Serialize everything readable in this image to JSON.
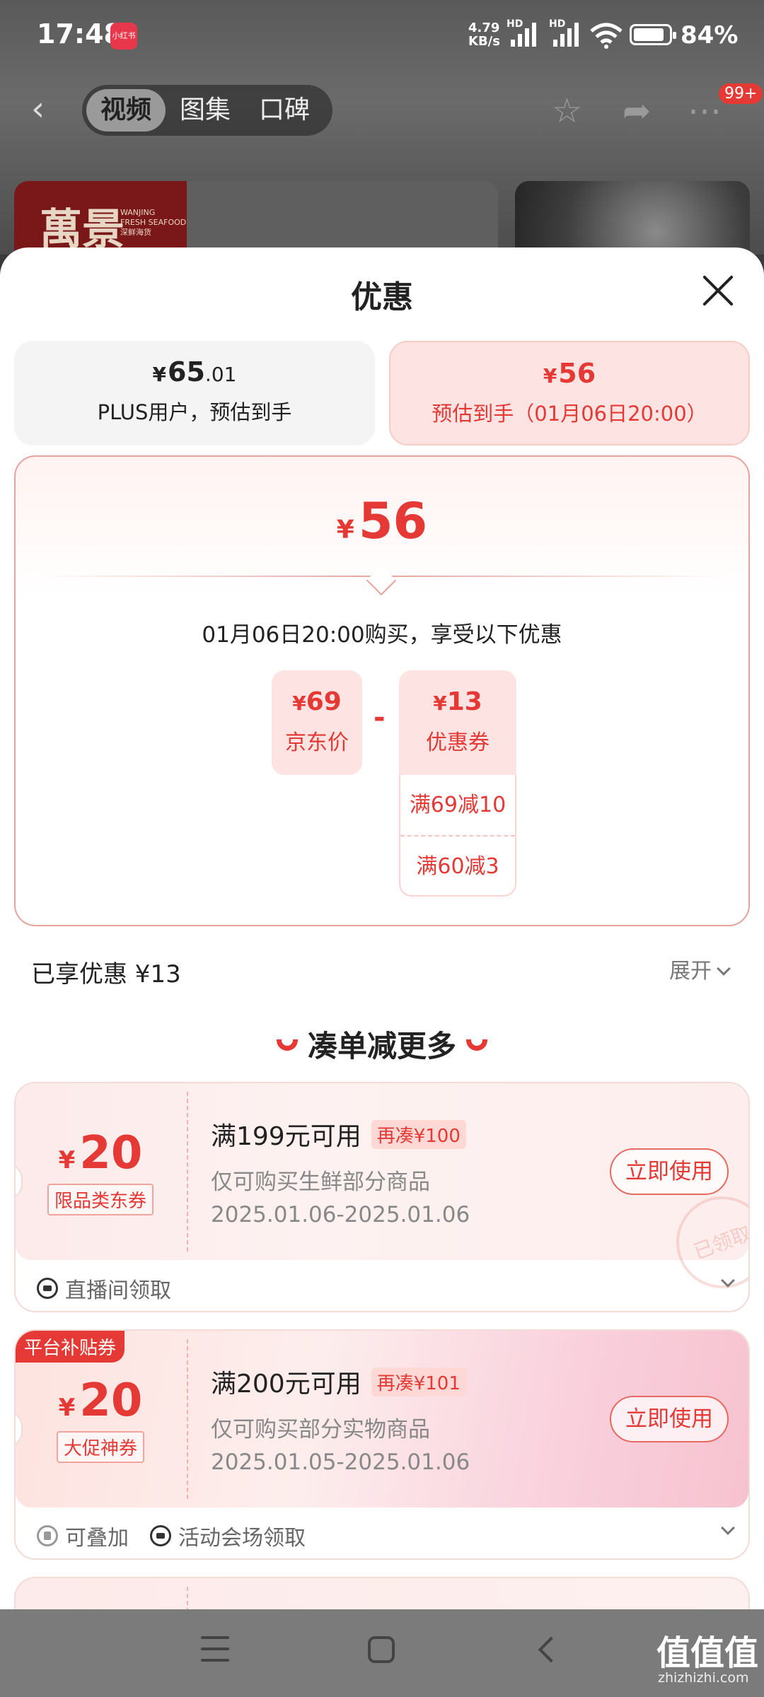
{
  "status_bar": {
    "time": "17:48",
    "app_icon_label": "小红书",
    "net_speed_value": "4.79",
    "net_speed_unit": "KB/s",
    "hd1": "HD",
    "hd2": "HD",
    "battery": "84%"
  },
  "top_nav": {
    "tabs": [
      {
        "label": "视频",
        "active": true
      },
      {
        "label": "图集",
        "active": false
      },
      {
        "label": "口碑",
        "active": false
      }
    ],
    "notification_badge": "99+"
  },
  "background_card": {
    "logo_big": "萬景",
    "logo_en1": "WANJING",
    "logo_en2": "FRESH SEAFOOD",
    "logo_cn_small": "深鲜海货"
  },
  "sheet": {
    "title": "优惠",
    "price_tabs": [
      {
        "currency": "¥",
        "price_int": "65",
        "price_dec": ".01",
        "desc": "PLUS用户，预估到手",
        "selected": false
      },
      {
        "currency": "¥",
        "price_int": "56",
        "price_dec": "",
        "desc": "预估到手（01月06日20:00）",
        "selected": true
      }
    ],
    "summary": {
      "currency": "¥",
      "price": "56",
      "buy_line": "01月06日20:00购买，享受以下优惠",
      "jd_price": {
        "currency": "¥",
        "value": "69",
        "label": "京东价"
      },
      "minus": "-",
      "coupon": {
        "currency": "¥",
        "value": "13",
        "label": "优惠券"
      },
      "coupon_rules": [
        "满69减10",
        "满60减3"
      ]
    },
    "enjoyed": "已享优惠 ¥13",
    "expand_label": "展开",
    "more_title": "凑单减更多"
  },
  "coupons": [
    {
      "currency": "¥",
      "amount": "20",
      "tag": "限品类东券",
      "condition": "满199元可用",
      "add_more": "再凑¥100",
      "scope": "仅可购买生鲜部分商品",
      "date": "2025.01.06-2025.01.06",
      "use_button": "立即使用",
      "stamp": "已领取",
      "footer": [
        {
          "icon": "ticket-icon",
          "label": "直播间领取"
        }
      ]
    },
    {
      "corner_label": "平台补贴券",
      "currency": "¥",
      "amount": "20",
      "tag": "大促神券",
      "condition": "满200元可用",
      "add_more": "再凑¥101",
      "scope": "仅可购买部分实物商品",
      "date": "2025.01.05-2025.01.06",
      "use_button": "立即使用",
      "footer": [
        {
          "icon": "stack-icon",
          "label": "可叠加"
        },
        {
          "icon": "ticket-icon",
          "label": "活动会场领取"
        }
      ]
    }
  ],
  "watermark": {
    "main": "值值值",
    "sub": "zhizhizhi.com"
  }
}
